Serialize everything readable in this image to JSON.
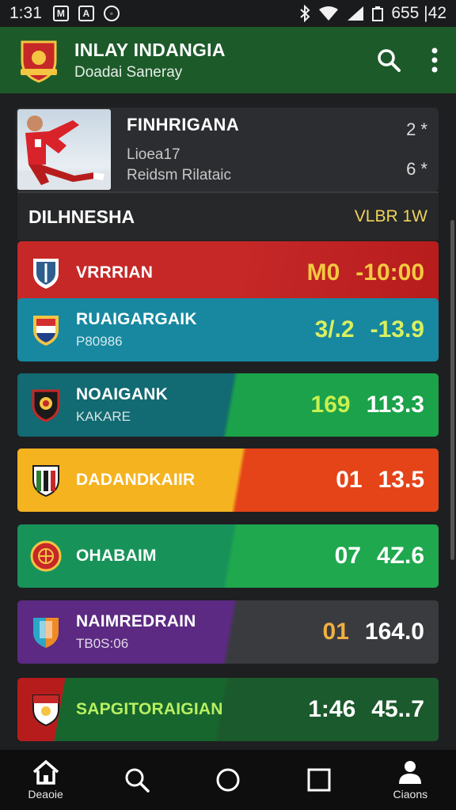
{
  "status_bar": {
    "time": "1:31",
    "right_text": "655 |42",
    "icons": [
      "mail-icon",
      "alert-icon",
      "photo-icon",
      "bluetooth-icon",
      "wifi-icon",
      "signal-icon",
      "battery-icon"
    ]
  },
  "app_bar": {
    "title": "INLAY INDANGIA",
    "subtitle": "Doadai Saneray",
    "actions": [
      "search-icon",
      "more-vert-icon"
    ],
    "brand_color": "#1d5a2a"
  },
  "featured": {
    "headline": "FINHRIGANA",
    "meta1": "Lioea17",
    "meta2": "Reidsm Rilataic",
    "count1": "2 *",
    "count2": "6 *"
  },
  "section": {
    "title": "DILHNESHA",
    "link": "VLBR 1W",
    "link_color": "#f0d35c"
  },
  "rows": [
    {
      "name": "VRRRIAN",
      "sub": "",
      "score1": "M0",
      "score2": "-10:00",
      "score1_color": "#f5c842",
      "score2_color": "#f5c842"
    },
    {
      "name": "RUAIGARGAIK",
      "sub": "P80986",
      "score1": "3/.2",
      "score2": "-13.9",
      "score1_color": "#d8f060",
      "score2_color": "#d8f060"
    },
    {
      "name": "NOAIGANK",
      "sub": "KAKARE",
      "score1": "169",
      "score2": "113.3",
      "score1_color": "#c8f050",
      "score2_color": "#ffffff"
    },
    {
      "name": "DADANDKAIIR",
      "sub": "",
      "score1": "01",
      "score2": "13.5",
      "score1_color": "#ffffff",
      "score2_color": "#ffffff"
    },
    {
      "name": "OHABAIM",
      "sub": "",
      "score1": "07",
      "score2": "4Z.6",
      "score1_color": "#ffffff",
      "score2_color": "#ffffff"
    },
    {
      "name": "NAIMREDRAIN",
      "sub": "TB0S:06",
      "score1": "01",
      "score2": "164.0",
      "score1_color": "#f0b040",
      "score2_color": "#ffffff"
    },
    {
      "name": "SAPGITORAIGIAN",
      "sub": "",
      "score1": "1:46",
      "score2": "45..7",
      "score1_color": "#ffffff",
      "score2_color": "#ffffff"
    }
  ],
  "nav": [
    {
      "label": "Deaoie",
      "icon": "home-icon"
    },
    {
      "label": "",
      "icon": "search-icon"
    },
    {
      "label": "",
      "icon": "circle-icon"
    },
    {
      "label": "",
      "icon": "square-icon"
    },
    {
      "label": "Ciaons",
      "icon": "profile-icon"
    }
  ]
}
